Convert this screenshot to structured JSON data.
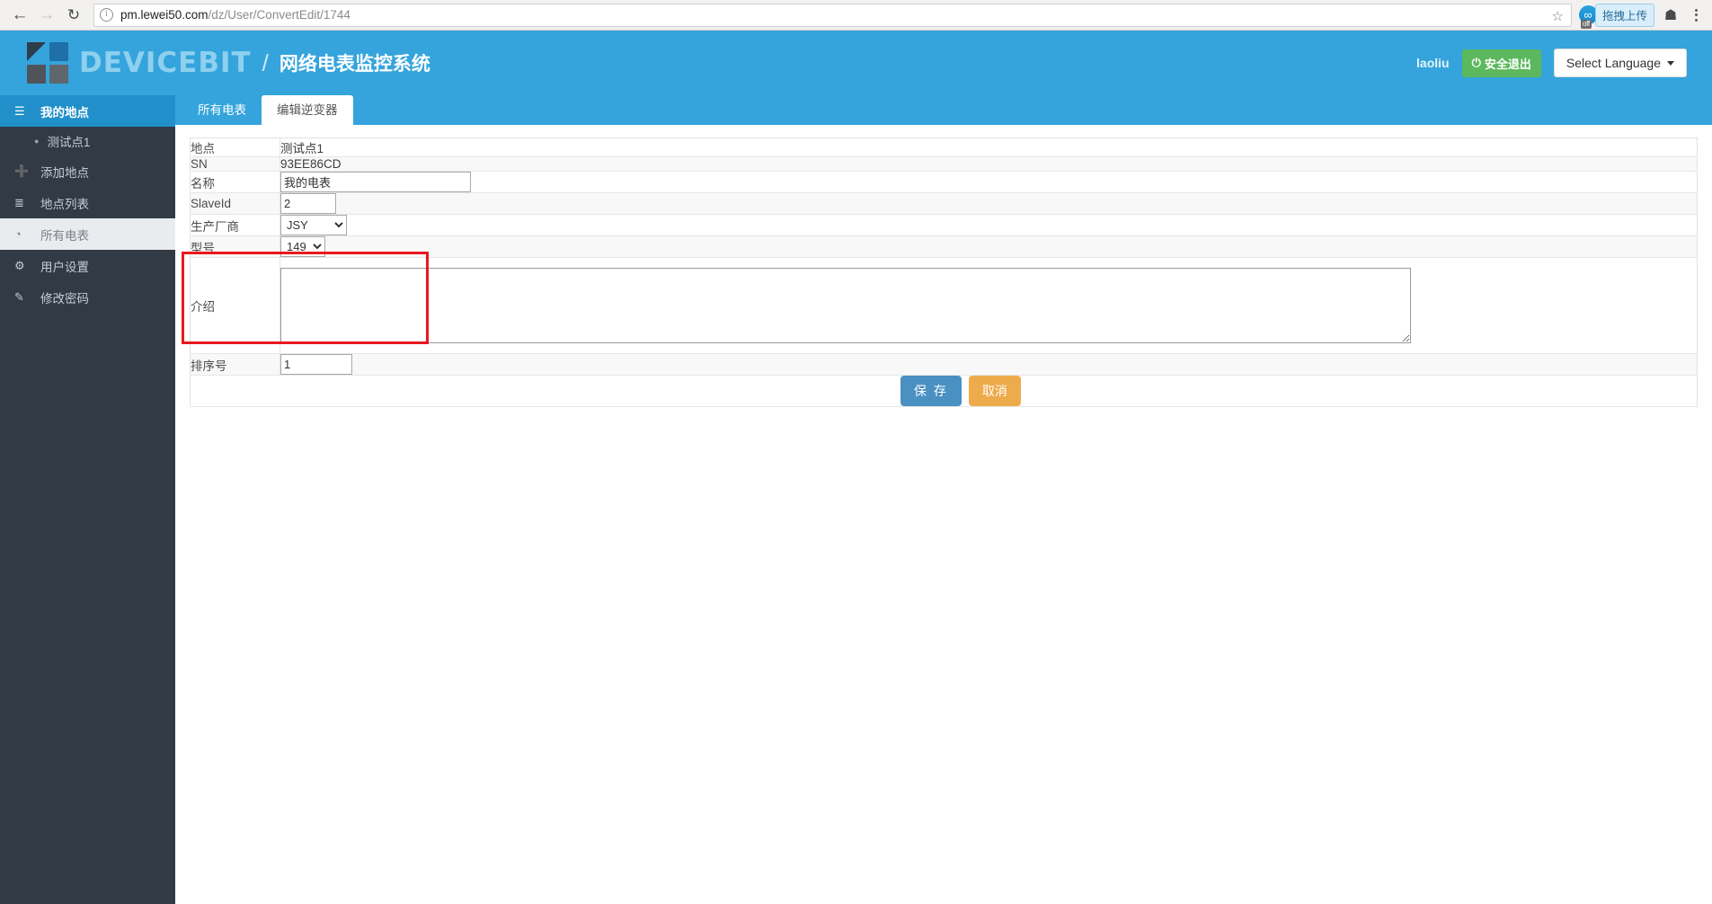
{
  "browser": {
    "back_icon": "back-arrow-icon",
    "forward_icon": "forward-arrow-icon",
    "reload_icon": "reload-icon",
    "info_glyph": "i",
    "url_domain": "pm.lewei50.com",
    "url_path": "/dz/User/ConvertEdit/1744",
    "star_glyph": "☆",
    "extensions": [
      {
        "name": "baidu-netdisk-extension",
        "glyph": "∞",
        "badge": "off",
        "tooltip": "拖拽上传"
      },
      {
        "name": "clipboard-extension",
        "glyph": "✂"
      },
      {
        "name": "shield-extension",
        "glyph": "▼"
      }
    ],
    "menu_icon": "kebab-menu-icon"
  },
  "navbar": {
    "brand": "DEVICEBIT",
    "separator": "/",
    "subtitle": "网络电表监控系统",
    "user": "laoliu",
    "logout_label": "安全退出",
    "logout_icon": "power-icon",
    "logout_glyph": "⏻",
    "language_label": "Select Language",
    "accent_blue": "#35a4dc",
    "logout_green": "#5cb85c"
  },
  "sidebar": {
    "items": [
      {
        "label": "我的地点",
        "icon": "list-icon",
        "glyph": "☰",
        "state": "active"
      },
      {
        "label": "添加地点",
        "icon": "plus-icon",
        "glyph": "➕",
        "state": "normal"
      },
      {
        "label": "地点列表",
        "icon": "list-lines-icon",
        "glyph": "≣",
        "state": "normal"
      },
      {
        "label": "所有电表",
        "icon": "meter-icon",
        "glyph": "◔",
        "state": "hover"
      },
      {
        "label": "用户设置",
        "icon": "gear-icon",
        "glyph": "⚙",
        "state": "normal"
      },
      {
        "label": "修改密码",
        "icon": "edit-icon",
        "glyph": "✎",
        "state": "normal"
      }
    ],
    "sub_item": {
      "label": "测试点1",
      "bullet": "●"
    }
  },
  "tabs": [
    {
      "label": "所有电表",
      "active": false
    },
    {
      "label": "编辑逆变器",
      "active": true
    }
  ],
  "form": {
    "rows": {
      "site": {
        "label": "地点",
        "value": "测试点1"
      },
      "sn": {
        "label": "SN",
        "value": "93EE86CD"
      },
      "name": {
        "label": "名称",
        "value": "我的电表",
        "placeholder": ""
      },
      "slaveid": {
        "label": "SlaveId",
        "value": "2",
        "placeholder": ""
      },
      "maker": {
        "label": "生产厂商",
        "value": "JSY"
      },
      "model": {
        "label": "型号",
        "value": "149"
      },
      "intro": {
        "label": "介绍",
        "value": "",
        "placeholder": ""
      },
      "order": {
        "label": "排序号",
        "value": "1",
        "placeholder": ""
      }
    },
    "save_label": "保 存",
    "cancel_label": "取消",
    "save_color": "#4a90c2",
    "cancel_color": "#eeab4c"
  },
  "annotation": {
    "name": "red-highlight-box",
    "color": "#e8181f"
  }
}
